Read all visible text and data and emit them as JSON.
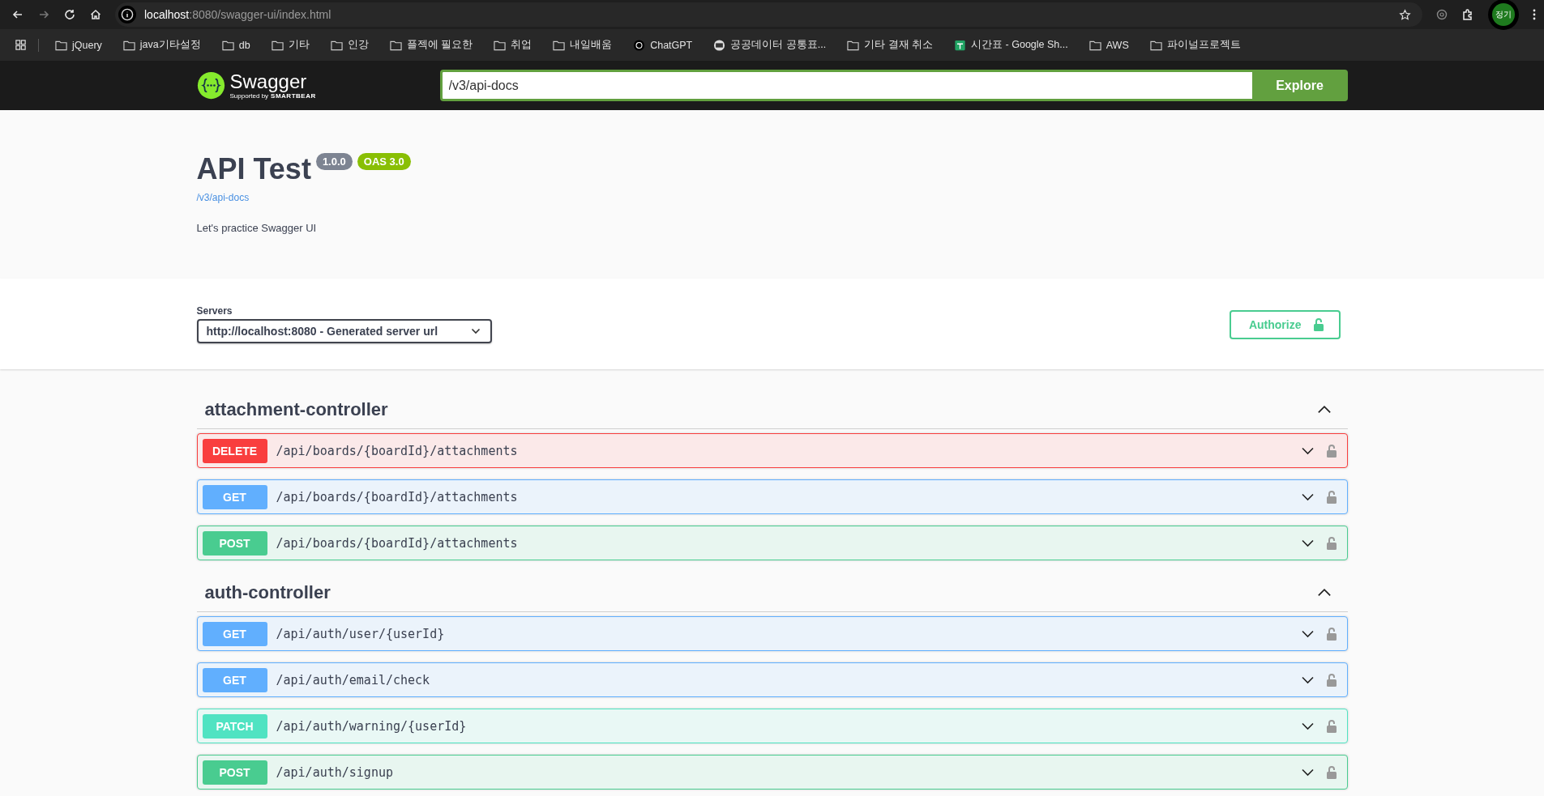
{
  "browser": {
    "url_host": "localhost",
    "url_rest": ":8080/swagger-ui/index.html",
    "profile": "정기"
  },
  "bookmarks": [
    {
      "label": "jQuery",
      "kind": "folder"
    },
    {
      "label": "java기타설정",
      "kind": "folder"
    },
    {
      "label": "db",
      "kind": "folder"
    },
    {
      "label": "기타",
      "kind": "folder"
    },
    {
      "label": "인강",
      "kind": "folder"
    },
    {
      "label": "플젝에 필요한",
      "kind": "folder"
    },
    {
      "label": "취업",
      "kind": "folder"
    },
    {
      "label": "내일배움",
      "kind": "folder"
    },
    {
      "label": "ChatGPT",
      "kind": "chatgpt"
    },
    {
      "label": "공공데이터 공통표...",
      "kind": "site"
    },
    {
      "label": "기타 결재 취소",
      "kind": "folder"
    },
    {
      "label": "시간표 - Google Sh...",
      "kind": "sheets"
    },
    {
      "label": "AWS",
      "kind": "folder"
    },
    {
      "label": "파이널프로젝트",
      "kind": "folder"
    }
  ],
  "topbar": {
    "logo_name": "Swagger",
    "logo_sub": "Supported by",
    "logo_brand": "SMARTBEAR",
    "url_value": "/v3/api-docs",
    "explore": "Explore"
  },
  "info": {
    "title": "API Test",
    "version": "1.0.0",
    "oas": "OAS 3.0",
    "link": "/v3/api-docs",
    "description": "Let's practice Swagger UI"
  },
  "servers": {
    "label": "Servers",
    "value": "http://localhost:8080 - Generated server url",
    "authorize": "Authorize"
  },
  "tags": [
    {
      "name": "attachment-controller",
      "expanded": true,
      "operations": [
        {
          "method": "DELETE",
          "kind": "delete",
          "path": "/api/boards/{boardId}/attachments"
        },
        {
          "method": "GET",
          "kind": "get",
          "path": "/api/boards/{boardId}/attachments"
        },
        {
          "method": "POST",
          "kind": "post",
          "path": "/api/boards/{boardId}/attachments"
        }
      ]
    },
    {
      "name": "auth-controller",
      "expanded": true,
      "operations": [
        {
          "method": "GET",
          "kind": "get",
          "path": "/api/auth/user/{userId}"
        },
        {
          "method": "GET",
          "kind": "get",
          "path": "/api/auth/email/check"
        },
        {
          "method": "PATCH",
          "kind": "patch",
          "path": "/api/auth/warning/{userId}"
        },
        {
          "method": "POST",
          "kind": "post",
          "path": "/api/auth/signup"
        }
      ]
    }
  ]
}
